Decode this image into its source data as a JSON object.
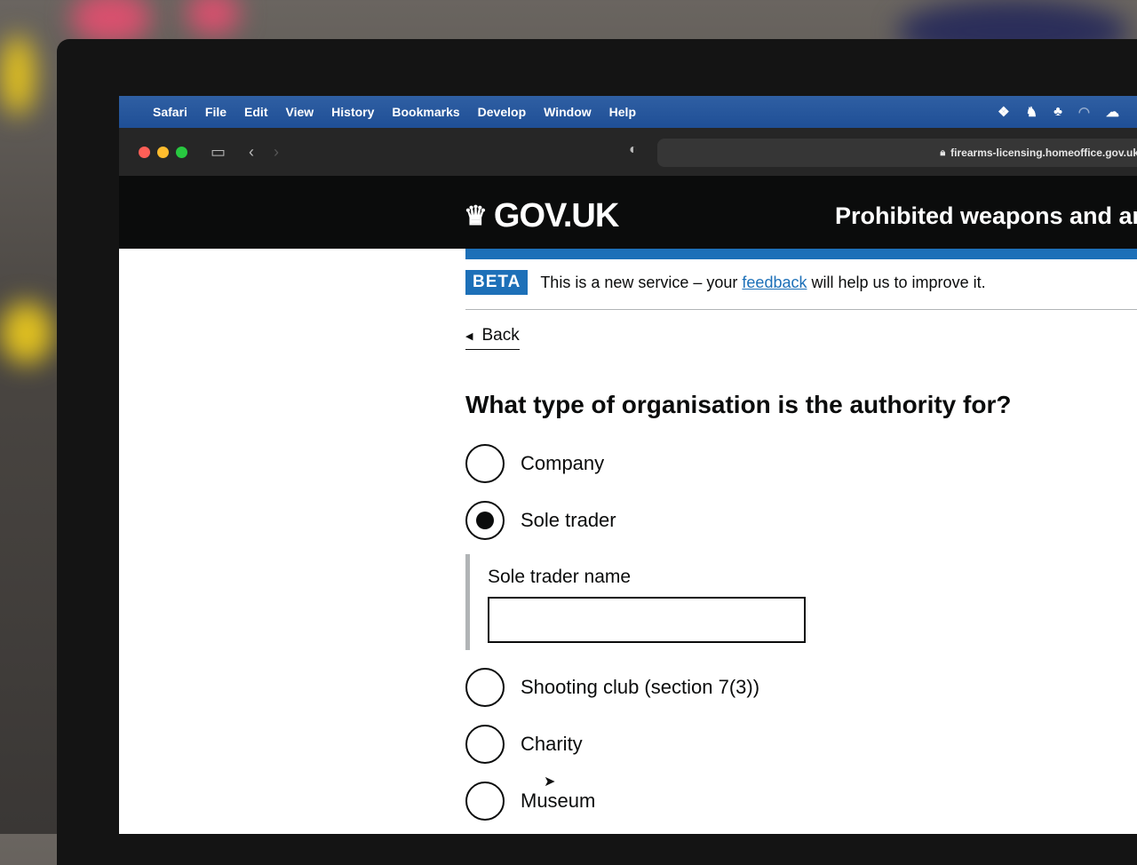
{
  "menubar": {
    "app": "Safari",
    "items": [
      "File",
      "Edit",
      "View",
      "History",
      "Bookmarks",
      "Develop",
      "Window",
      "Help"
    ]
  },
  "browser": {
    "url": "firearms-licensing.homeoffice.gov.uk"
  },
  "header": {
    "logo_text": "GOV.UK",
    "service_name": "Prohibited weapons and am"
  },
  "phase_banner": {
    "tag": "BETA",
    "text_before": "This is a new service – your",
    "link": "feedback",
    "text_after": "will help us to improve it."
  },
  "back_link": "Back",
  "question": "What type of organisation is the authority for?",
  "options": [
    {
      "label": "Company",
      "checked": false
    },
    {
      "label": "Sole trader",
      "checked": true
    },
    {
      "label": "Shooting club (section 7(3))",
      "checked": false
    },
    {
      "label": "Charity",
      "checked": false
    },
    {
      "label": "Museum",
      "checked": false
    }
  ],
  "conditional": {
    "label": "Sole trader name",
    "value": ""
  },
  "colors": {
    "gov_black": "#0b0c0c",
    "gov_blue": "#1d70b8",
    "menubar_blue": "#1f4f96"
  }
}
